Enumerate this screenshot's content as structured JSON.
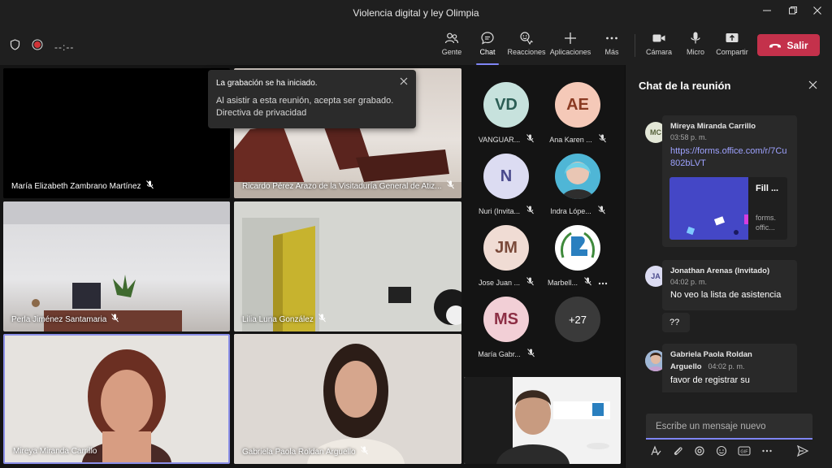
{
  "window": {
    "title": "Violencia digital y ley Olimpia"
  },
  "toolbar": {
    "timer": "--:--",
    "tools": [
      {
        "label": "Gente",
        "icon": "people-icon"
      },
      {
        "label": "Chat",
        "icon": "chat-icon"
      },
      {
        "label": "Reacciones",
        "icon": "reactions-icon"
      },
      {
        "label": "Aplicaciones",
        "icon": "plus-icon"
      },
      {
        "label": "Más",
        "icon": "more-icon"
      },
      {
        "label": "Cámara",
        "icon": "camera-icon"
      },
      {
        "label": "Micro",
        "icon": "microphone-icon"
      },
      {
        "label": "Compartir",
        "icon": "share-icon"
      }
    ],
    "active_tool": "Chat",
    "leave_label": "Salir"
  },
  "notification": {
    "title": "La grabación se ha iniciado.",
    "body": "Al asistir a esta reunión, acepta ser grabado.",
    "link": "Directiva de privacidad"
  },
  "video_tiles": [
    {
      "name": "María Elizabeth Zambrano Martínez"
    },
    {
      "name": "Ricardo Pérez Arazo de la Visitaduría General de Atiz..."
    },
    {
      "name": "Perla Jiménez Santamaria"
    },
    {
      "name": "Lilia Luna González"
    },
    {
      "name": "Mireya Miranda Carrillo"
    },
    {
      "name": "Gabriela Paola Roldan Arguello"
    }
  ],
  "participants": [
    {
      "initials": "VD",
      "name": "VANGUAR...",
      "color": "#c7e2dd",
      "text_color": "#2c5e55"
    },
    {
      "initials": "AE",
      "name": "Ana Karen ...",
      "color": "#f5c9b8",
      "text_color": "#8a3a22"
    },
    {
      "initials": "N",
      "name": "Nuri (Invita...",
      "color": "#dcdcf2",
      "text_color": "#4a4a8c"
    },
    {
      "initials": "",
      "name": "Indra Lópe...",
      "color": "#4fb6d6",
      "text_color": "#ffffff"
    },
    {
      "initials": "JM",
      "name": "Jose Juan ...",
      "color": "#f0dcd4",
      "text_color": "#7a4a3a"
    },
    {
      "initials": "",
      "name": "Marbell...",
      "color": "#ffffff",
      "text_color": "#2a7fbf"
    },
    {
      "initials": "MS",
      "name": "María Gabr...",
      "color": "#f2cfd6",
      "text_color": "#8c2e44"
    },
    {
      "initials": "+27",
      "name": "",
      "color": "#3a3a3a",
      "text_color": "#ffffff"
    }
  ],
  "chat": {
    "title": "Chat de la reunión",
    "messages": [
      {
        "initials": "MC",
        "author": "Mireya Miranda Carrillo",
        "time": "03:58 p. m.",
        "link": "https://forms.office.com/r/7Cu802bLVT",
        "card_title": "Fill ...",
        "card_source": "forms. offic..."
      },
      {
        "initials": "JA",
        "author": "Jonathan Arenas (Invitado)",
        "time": "04:02 p. m.",
        "text": "No veo la lista de asistencia",
        "followup": "??"
      },
      {
        "initials": "",
        "author": "Gabriela Paola Roldan Arguello",
        "author_line1": "Gabriela Paola Roldan",
        "author_line2": "Arguello",
        "time": "04:02 p. m.",
        "text": "favor de registrar su"
      }
    ],
    "compose_placeholder": "Escribe un mensaje nuevo"
  },
  "colors": {
    "accent": "#7f85f5",
    "leave": "#c4314b",
    "background": "#141414",
    "panel": "#1f1f1f"
  }
}
